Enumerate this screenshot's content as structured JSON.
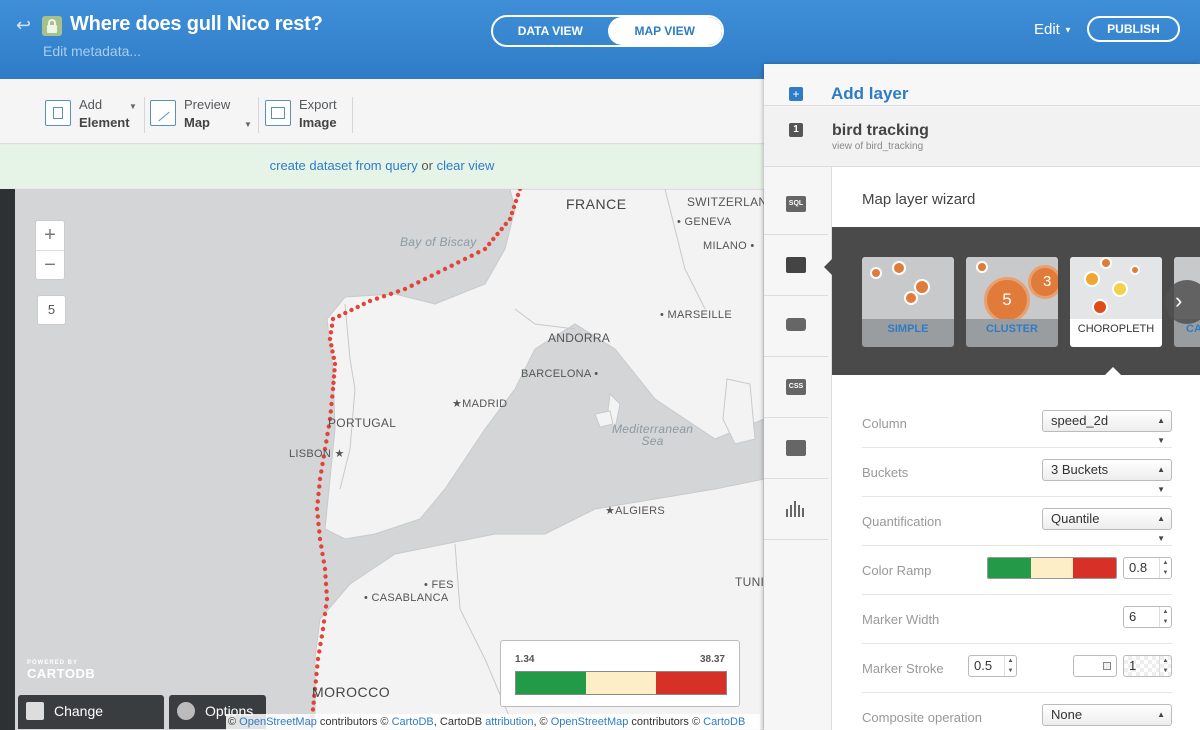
{
  "header": {
    "title": "Where does gull Nico rest?",
    "meta_link": "Edit metadata...",
    "views": [
      {
        "label": "DATA VIEW",
        "active": false
      },
      {
        "label": "MAP VIEW",
        "active": true
      }
    ],
    "edit_label": "Edit",
    "publish_label": "PUBLISH"
  },
  "toolbar": {
    "tools": [
      {
        "line1": "Add",
        "line2": "Element",
        "icon": "add-element-icon"
      },
      {
        "line1": "Preview",
        "line2": "Map",
        "icon": "preview-map-icon"
      },
      {
        "line1": "Export",
        "line2": "Image",
        "icon": "export-image-icon"
      }
    ]
  },
  "notice": {
    "link1": "create dataset from query",
    "middle": " or ",
    "link2": "clear view"
  },
  "map": {
    "zoom_in": "+",
    "zoom_out": "−",
    "zoom_level": "5",
    "labels": {
      "france": "FRANCE",
      "switzerland": "SWITZERLAND",
      "geneva": "GENEVA",
      "milano": "MILANO",
      "biscay": "Bay of Biscay",
      "andorra": "ANDORRA",
      "marseille": "MARSEILLE",
      "barcelona": "BARCELONA",
      "madrid": "MADRID",
      "portugal": "PORTUGAL",
      "lisbon": "LISBON",
      "med1": "Mediterranean",
      "med2": "Sea",
      "algiers": "ALGIERS",
      "fes": "FES",
      "casablanca": "CASABLANCA",
      "tunis": "TUNIS",
      "morocco": "MOROCCO"
    },
    "powered_by": "POWERED BY",
    "logo_text": "CARTODB",
    "change_basemap": "Change basemap",
    "options": "Options",
    "attribution": {
      "c1": "© ",
      "osm1": "OpenStreetMap",
      "t1": " contributors © ",
      "cartodb1": "CartoDB",
      "t2": ", CartoDB ",
      "attr": "attribution",
      "t3": ", © ",
      "osm2": "OpenStreetMap",
      "t4": " contributors © ",
      "cartodb2": "CartoDB"
    },
    "legend": {
      "min": "1.34",
      "max": "38.37",
      "colors": [
        "#229a48",
        "#fdeec8",
        "#d73027"
      ]
    },
    "track_color": "#e0453a"
  },
  "panel": {
    "add_layer": "Add layer",
    "layer_number": "1",
    "layer_name": "bird tracking",
    "layer_sub": "view of bird_tracking",
    "side_tabs": [
      {
        "icon": "sql-icon",
        "text": "SQL"
      },
      {
        "icon": "wizard-brush-icon",
        "text": ""
      },
      {
        "icon": "infowindow-icon",
        "text": ""
      },
      {
        "icon": "css-icon",
        "text": "CSS"
      },
      {
        "icon": "legend-icon",
        "text": ""
      },
      {
        "icon": "filters-icon",
        "text": ""
      }
    ],
    "wizard_title": "Map layer wizard",
    "types": [
      {
        "label": "SIMPLE",
        "selected": false
      },
      {
        "label": "CLUSTER",
        "selected": false,
        "badge": "5",
        "badge2": "3"
      },
      {
        "label": "CHOROPLETH",
        "selected": true
      },
      {
        "label": "CA",
        "selected": false
      }
    ],
    "props": {
      "column": {
        "label": "Column",
        "value": "speed_2d"
      },
      "buckets": {
        "label": "Buckets",
        "value": "3 Buckets"
      },
      "quantification": {
        "label": "Quantification",
        "value": "Quantile"
      },
      "color_ramp": {
        "label": "Color Ramp",
        "opacity": "0.8",
        "colors": [
          "#229a48",
          "#fdeec8",
          "#d73027"
        ]
      },
      "marker_width": {
        "label": "Marker Width",
        "value": "6"
      },
      "marker_stroke": {
        "label": "Marker Stroke",
        "width": "0.5",
        "opacity": "1"
      },
      "composite": {
        "label": "Composite operation",
        "value": "None"
      }
    }
  }
}
